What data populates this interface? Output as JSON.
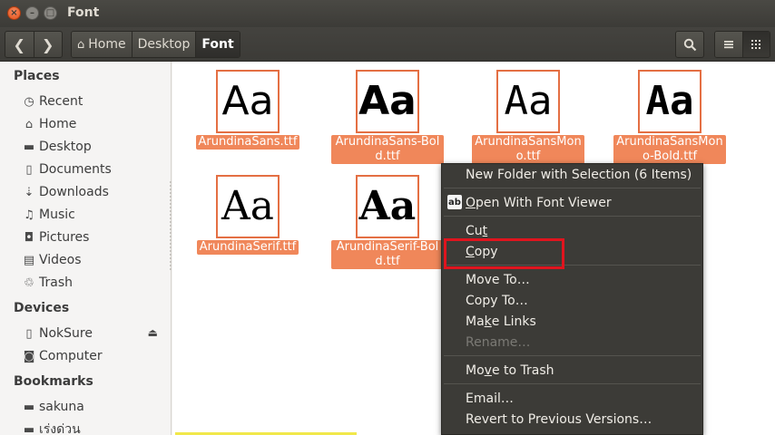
{
  "window": {
    "title": "Font",
    "close_glyph": "×",
    "minimize_glyph": "–",
    "maximize_glyph": "□"
  },
  "toolbar": {
    "back_glyph": "❮",
    "forward_glyph": "❯",
    "breadcrumbs": [
      "Home",
      "Desktop",
      "Font"
    ],
    "search_glyph": "⚲",
    "list_view_glyph": "☰",
    "grid_view_glyph": "⋮⋮⋮"
  },
  "sidebar": {
    "places_header": "Places",
    "places": [
      {
        "label": "Recent",
        "icon": "clock-icon",
        "glyph": "◷"
      },
      {
        "label": "Home",
        "icon": "home-icon",
        "glyph": "⌂"
      },
      {
        "label": "Desktop",
        "icon": "folder-icon",
        "glyph": "▬"
      },
      {
        "label": "Documents",
        "icon": "document-icon",
        "glyph": "▯"
      },
      {
        "label": "Downloads",
        "icon": "download-icon",
        "glyph": "⇣"
      },
      {
        "label": "Music",
        "icon": "music-icon",
        "glyph": "♫"
      },
      {
        "label": "Pictures",
        "icon": "camera-icon",
        "glyph": "◘"
      },
      {
        "label": "Videos",
        "icon": "film-icon",
        "glyph": "▤"
      },
      {
        "label": "Trash",
        "icon": "trash-icon",
        "glyph": "♲"
      }
    ],
    "devices_header": "Devices",
    "devices": [
      {
        "label": "NokSure",
        "icon": "phone-icon",
        "glyph": "▯",
        "eject_glyph": "⏏"
      },
      {
        "label": "Computer",
        "icon": "drive-icon",
        "glyph": "◙"
      }
    ],
    "bookmarks_header": "Bookmarks",
    "bookmarks": [
      {
        "label": "sakuna",
        "icon": "folder-icon",
        "glyph": "▬"
      },
      {
        "label": "เร่งด่วน",
        "icon": "folder-icon",
        "glyph": "▬"
      }
    ]
  },
  "files": [
    {
      "name": "ArundinaSans.ttf",
      "preview": "Aa",
      "style": "sans"
    },
    {
      "name": "ArundinaSans-Bold.ttf",
      "preview": "Aa",
      "style": "sans bold"
    },
    {
      "name": "ArundinaSansMono.ttf",
      "preview": "Aa",
      "style": "mono"
    },
    {
      "name": "ArundinaSansMono-Bold.ttf",
      "preview": "Aa",
      "style": "mono bold"
    },
    {
      "name": "ArundinaSerif.ttf",
      "preview": "Aa",
      "style": "serif"
    },
    {
      "name": "ArundinaSerif-Bold.ttf",
      "preview": "Aa",
      "style": "serif bold"
    }
  ],
  "context_menu": {
    "new_folder": "New Folder with Selection (6 Items)",
    "open_with_prefix": "O",
    "open_with_rest": "pen With Font Viewer",
    "open_icon_text": "ab",
    "cut_prefix": "Cu",
    "cut_u": "t",
    "copy_u": "C",
    "copy_rest": "opy",
    "move_to": "Move To…",
    "copy_to": "Copy To…",
    "make_links_a": "Ma",
    "make_links_u": "k",
    "make_links_b": "e Links",
    "rename": "Rename…",
    "move_trash_a": "Mo",
    "move_trash_u": "v",
    "move_trash_b": "e to Trash",
    "email": "Email…",
    "revert": "Revert to Previous Versions…"
  },
  "colors": {
    "selection": "#f0875a",
    "thumb_border": "#e46f43",
    "highlight": "#e0141e",
    "menu_bg": "#3c3b37"
  }
}
